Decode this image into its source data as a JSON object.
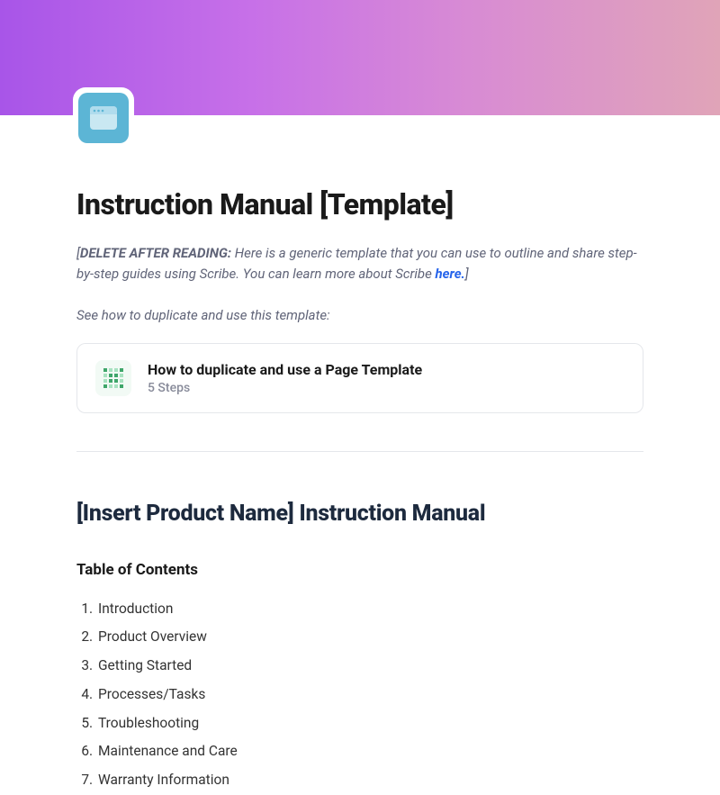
{
  "page": {
    "title": "Instruction Manual [Template]",
    "iconName": "window-icon"
  },
  "deleteNote": {
    "prefix": "[",
    "bold": "DELETE AFTER READING:",
    "body": " Here is a generic template that you can use to outline and share step-by-step guides using Scribe. You can learn more about Scribe ",
    "linkText": "here.",
    "suffix": "]"
  },
  "seeHow": "See how to duplicate and use this template:",
  "templateCard": {
    "title": "How to duplicate and use a Page Template",
    "steps": "5 Steps"
  },
  "sectionHeading": "[Insert Product Name] Instruction Manual",
  "toc": {
    "heading": "Table of Contents",
    "items": [
      "Introduction",
      "Product Overview",
      "Getting Started",
      "Processes/Tasks",
      "Troubleshooting",
      "Maintenance and Care",
      "Warranty Information"
    ]
  }
}
